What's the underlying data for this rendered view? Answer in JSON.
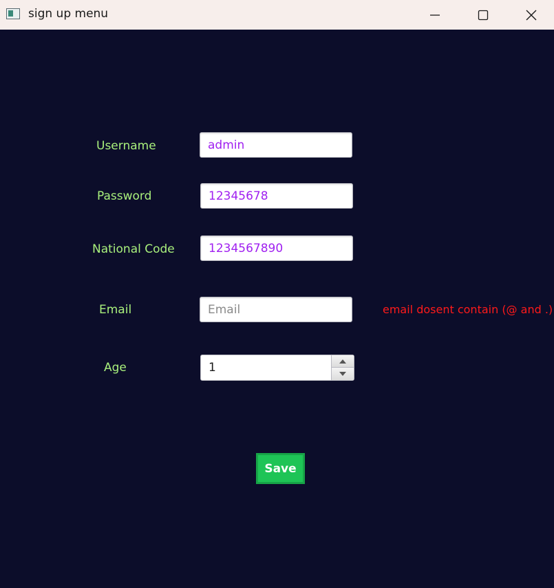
{
  "window": {
    "title": "sign up menu",
    "controls": {
      "minimize_icon": "minimize-icon",
      "maximize_icon": "maximize-icon",
      "close_icon": "close-icon"
    }
  },
  "form": {
    "username": {
      "label": "Username",
      "value": "admin"
    },
    "password": {
      "label": "Password",
      "value": "12345678"
    },
    "national_code": {
      "label": "National Code",
      "value": "1234567890"
    },
    "email": {
      "label": "Email",
      "value": "",
      "placeholder": "Email",
      "error": "email dosent contain (@ and .)"
    },
    "age": {
      "label": "Age",
      "value": "1"
    },
    "save_label": "Save"
  },
  "colors": {
    "background": "#0c0d2a",
    "label": "#a9f07c",
    "input_text": "#a020f0",
    "error": "#ff1a1a",
    "save_button": "#1ec456"
  }
}
